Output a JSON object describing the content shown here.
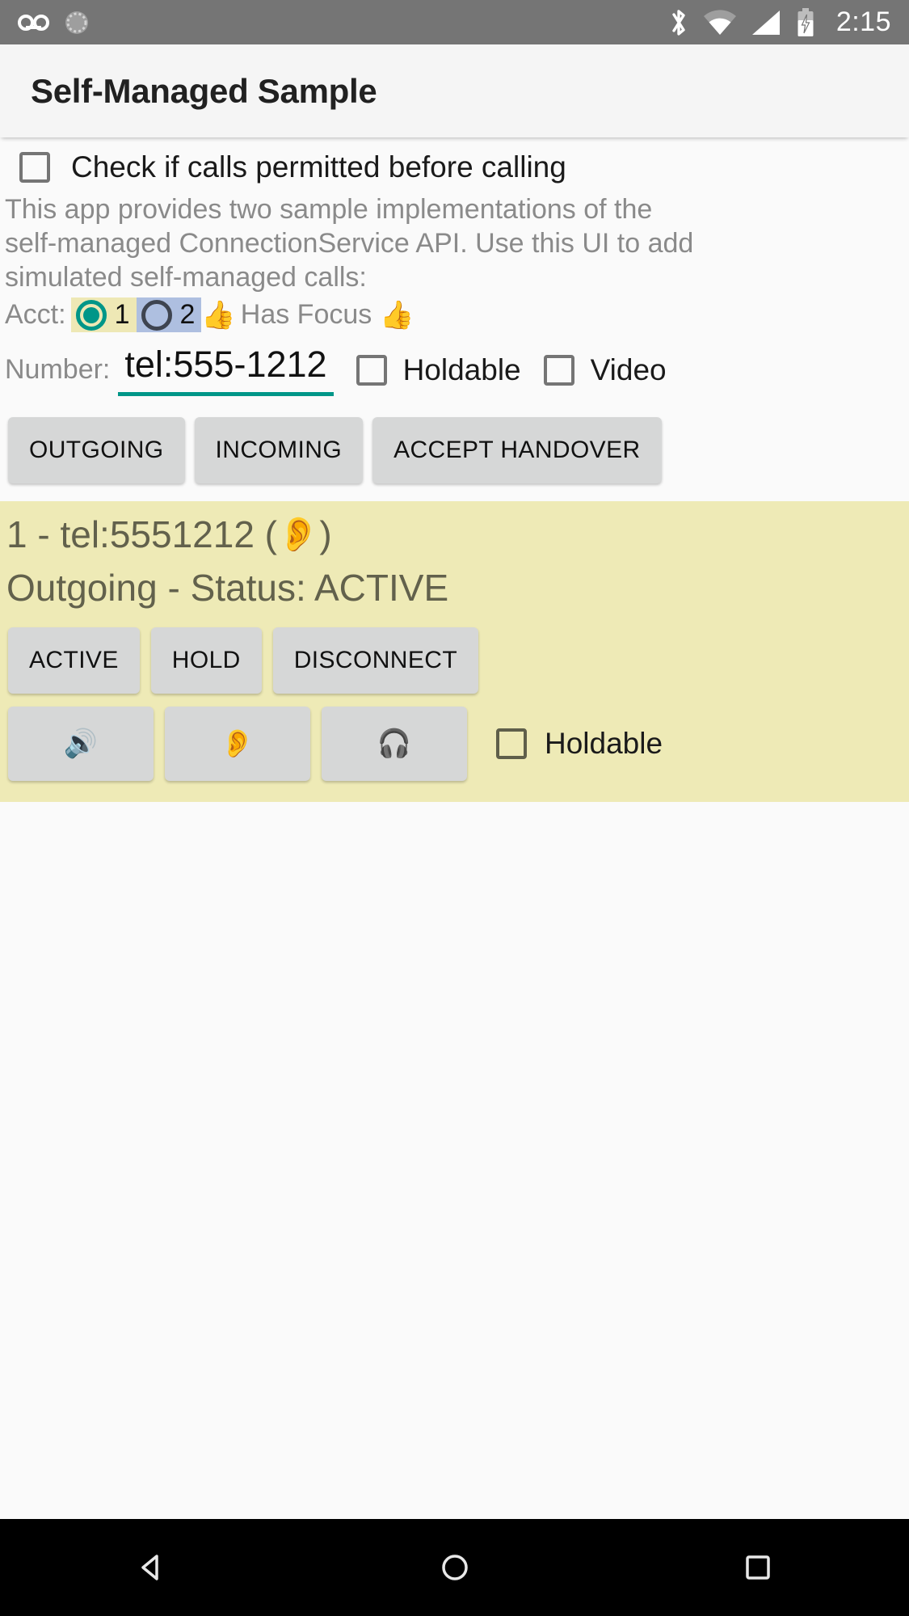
{
  "statusbar": {
    "icons_left": [
      "voicemail-icon",
      "sync-icon"
    ],
    "icons_right": [
      "bluetooth-icon",
      "wifi-icon",
      "signal-icon",
      "battery-charging-icon"
    ],
    "clock": "2:15"
  },
  "actionbar": {
    "title": "Self-Managed Sample"
  },
  "permit": {
    "label": "Check if calls permitted before calling",
    "checked": false
  },
  "description": {
    "line1": "This app provides two sample implementations of the",
    "line2": "self-managed ConnectionService API.  Use this UI to add",
    "line3": "simulated self-managed calls:"
  },
  "account": {
    "label": "Acct:",
    "options": [
      {
        "value": "1",
        "selected": true
      },
      {
        "value": "2",
        "selected": false
      }
    ],
    "focus_text": "Has Focus",
    "thumb_left": "👍",
    "thumb_right": "👍"
  },
  "number": {
    "label": "Number:",
    "value": "tel:555-1212",
    "placeholder": "tel:555-1212",
    "holdable_label": "Holdable",
    "holdable_checked": false,
    "video_label": "Video",
    "video_checked": false
  },
  "actions": {
    "outgoing": "OUTGOING",
    "incoming": "INCOMING",
    "accept_handover": "ACCEPT HANDOVER"
  },
  "call": {
    "header_prefix": "1 - tel:5551212 ( ",
    "header_icon": "👂",
    "header_suffix": " )",
    "status_line": "Outgoing - Status: ACTIVE",
    "buttons": {
      "active": "ACTIVE",
      "hold": "HOLD",
      "disconnect": "DISCONNECT"
    },
    "audio_routes": [
      {
        "name": "speaker-icon",
        "glyph": "🔊"
      },
      {
        "name": "earpiece-icon",
        "glyph": "👂"
      },
      {
        "name": "headset-icon",
        "glyph": "🎧"
      }
    ],
    "holdable_label": "Holdable",
    "holdable_checked": false
  },
  "navbar": {
    "back": "back-icon",
    "home": "home-icon",
    "recents": "recents-icon"
  },
  "colors": {
    "status_bar": "#757575",
    "action_bar": "#f5f5f5",
    "accent_teal": "#009688",
    "call_card": "#eeeab6",
    "acct1_bg": "#eee8b5",
    "acct2_bg": "#aebfe0",
    "button_gray": "#d6d7d7"
  }
}
